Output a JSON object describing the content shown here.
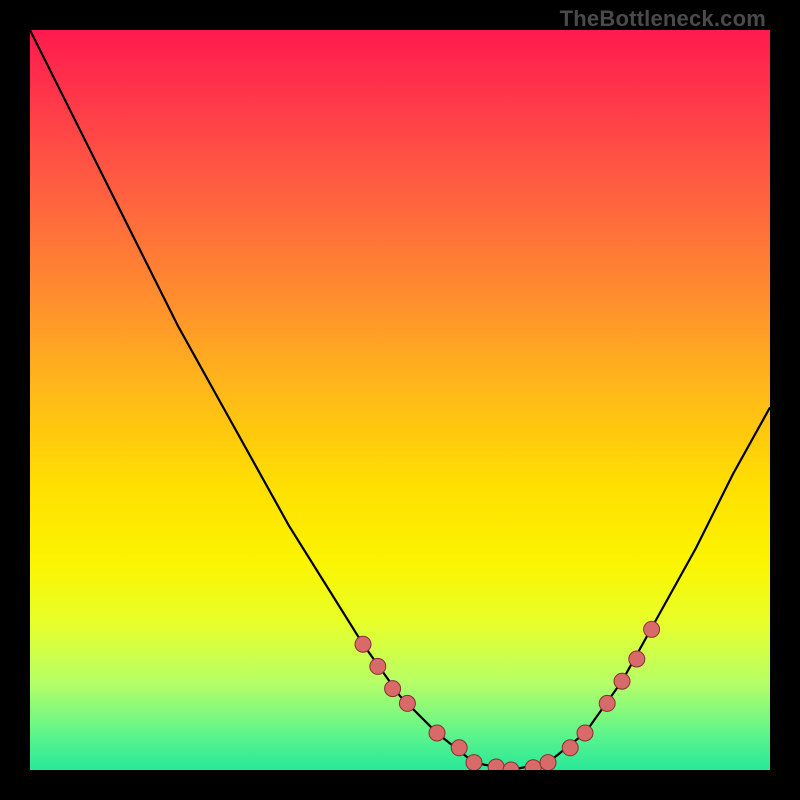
{
  "attribution": "TheBottleneck.com",
  "colors": {
    "frame": "#000000",
    "gradient_top": "#ff1a4d",
    "gradient_bottom": "#28e89a",
    "curve": "#000000",
    "marker_fill": "#d86a6a",
    "marker_stroke": "#8a2f2f"
  },
  "chart_data": {
    "type": "line",
    "title": "",
    "xlabel": "",
    "ylabel": "",
    "xlim": [
      0,
      100
    ],
    "ylim": [
      0,
      100
    ],
    "x": [
      0,
      5,
      10,
      15,
      20,
      25,
      30,
      35,
      40,
      45,
      50,
      55,
      60,
      65,
      70,
      75,
      80,
      85,
      90,
      95,
      100
    ],
    "values": [
      100,
      90,
      80,
      70,
      60,
      51,
      42,
      33,
      25,
      17,
      10,
      5,
      1,
      0,
      1,
      5,
      12,
      21,
      30,
      40,
      49
    ],
    "series": [
      {
        "name": "curve",
        "x": [
          0,
          5,
          10,
          15,
          20,
          25,
          30,
          35,
          40,
          45,
          50,
          55,
          60,
          65,
          70,
          75,
          80,
          85,
          90,
          95,
          100
        ],
        "values": [
          100,
          90,
          80,
          70,
          60,
          51,
          42,
          33,
          25,
          17,
          10,
          5,
          1,
          0,
          1,
          5,
          12,
          21,
          30,
          40,
          49
        ]
      },
      {
        "name": "markers",
        "x": [
          45,
          47,
          49,
          51,
          55,
          58,
          60,
          63,
          65,
          68,
          70,
          73,
          75,
          78,
          80,
          82,
          84
        ],
        "values": [
          17,
          14,
          11,
          9,
          5,
          3,
          1,
          0.4,
          0,
          0.3,
          1,
          3,
          5,
          9,
          12,
          15,
          19
        ]
      }
    ]
  }
}
